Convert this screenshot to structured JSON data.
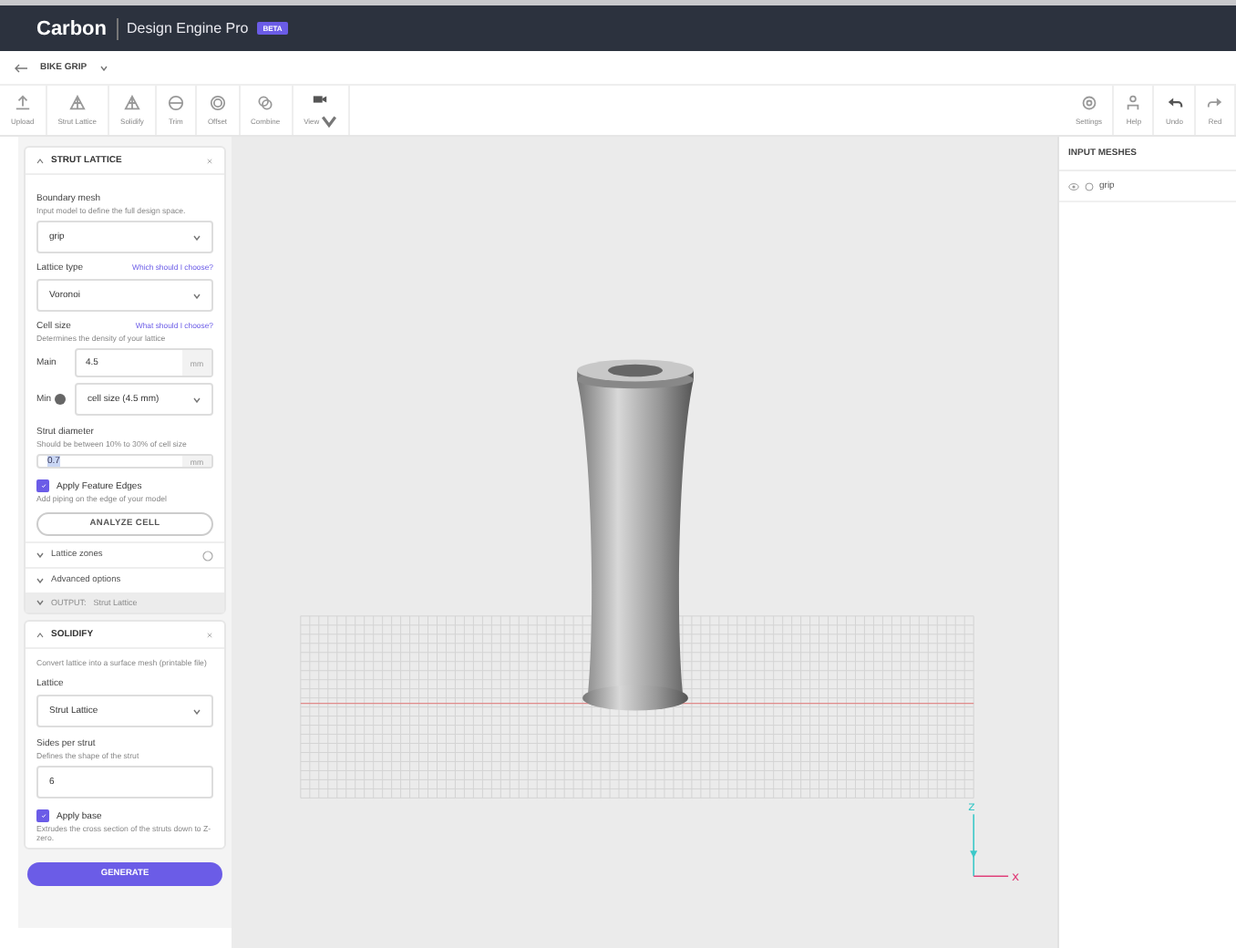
{
  "app": {
    "logo": "Carbon",
    "product": "Design Engine Pro",
    "badge": "BETA"
  },
  "breadcrumb": {
    "project": "BIKE GRIP"
  },
  "toolbar": [
    {
      "label": "Upload",
      "kind": "upload"
    },
    {
      "label": "Strut Lattice",
      "kind": "lattice"
    },
    {
      "label": "Solidify",
      "kind": "lattice"
    },
    {
      "label": "Trim",
      "kind": "trim"
    },
    {
      "label": "Offset",
      "kind": "offset"
    },
    {
      "label": "Combine",
      "kind": "combine"
    },
    {
      "label": "View",
      "kind": "camera",
      "dropdown": true
    }
  ],
  "right_toolbar": [
    {
      "label": "Settings",
      "kind": "gear"
    },
    {
      "label": "Help",
      "kind": "person"
    },
    {
      "label": "Undo",
      "kind": "undo"
    },
    {
      "label": "Red",
      "kind": "redo"
    }
  ],
  "strut_lattice": {
    "title": "STRUT LATTICE",
    "boundary": {
      "label": "Boundary mesh",
      "hint": "Input model to define the full design space.",
      "value": "grip"
    },
    "lattice_type": {
      "label": "Lattice type",
      "link": "Which should I choose?",
      "value": "Voronoi"
    },
    "cell_size": {
      "label": "Cell size",
      "link": "What should I choose?",
      "hint": "Determines the density of your lattice",
      "main_label": "Main",
      "main_value": "4.5",
      "unit": "mm",
      "min_label": "Min",
      "min_value": "cell size (4.5 mm)"
    },
    "strut_diameter": {
      "label": "Strut diameter",
      "hint": "Should be between 10% to 30% of cell size",
      "value": "0.7",
      "unit": "mm"
    },
    "feature_edges": {
      "label": "Apply Feature Edges",
      "checked": true,
      "hint": "Add piping on the edge of your model"
    },
    "analyze": "ANALYZE CELL",
    "sections": [
      {
        "label": "Lattice zones",
        "expanded": false,
        "info": true
      },
      {
        "label": "Advanced options",
        "expanded": false,
        "info": false
      }
    ],
    "output": {
      "label": "OUTPUT:",
      "value": "Strut Lattice"
    }
  },
  "solidify": {
    "title": "SOLIDIFY",
    "hint": "Convert lattice into a surface mesh (printable file)",
    "lattice": {
      "label": "Lattice",
      "value": "Strut Lattice"
    },
    "sides": {
      "label": "Sides per strut",
      "hint": "Defines the shape of the strut",
      "value": "6"
    },
    "base": {
      "label": "Apply base",
      "checked": true,
      "hint": "Extrudes the cross section of the struts down to Z-zero."
    }
  },
  "generate": "GENERATE",
  "axes": {
    "z": "z",
    "x": "x"
  },
  "input_meshes": {
    "title": "INPUT MESHES",
    "items": [
      {
        "name": "grip",
        "visible": true
      }
    ]
  }
}
